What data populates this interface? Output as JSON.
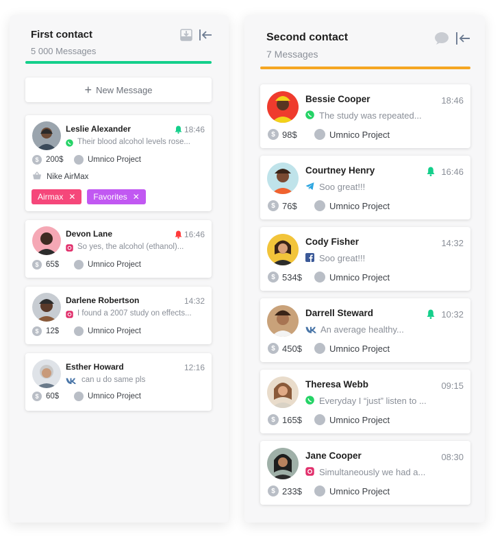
{
  "colors": {
    "green": "#14cf8b",
    "orange": "#f5a623",
    "red": "#ff3b3b",
    "tag_pink": "#f5477a",
    "tag_purple": "#c158f2",
    "muted": "#8a8f98"
  },
  "first_column": {
    "title": "First contact",
    "count": "5 000 Messages",
    "icons": [
      "inbox-download-icon",
      "collapse-left-icon"
    ],
    "new_message_label": "New Message",
    "cards": [
      {
        "name": "Leslie Alexander",
        "time": "18:46",
        "bell": "green",
        "channel": "whatsapp-icon",
        "preview": "Their blood alcohol levels rose...",
        "amount": "200$",
        "project": "Umnico Project",
        "product": "Nike AirMax",
        "tags": [
          {
            "label": "Airmax",
            "color": "#f5477a"
          },
          {
            "label": "Favorites",
            "color": "#c158f2"
          }
        ]
      },
      {
        "name": "Devon Lane",
        "time": "16:46",
        "bell": "red",
        "channel": "instagram-icon",
        "preview": "So yes, the alcohol (ethanol)...",
        "amount": "65$",
        "project": "Umnico Project"
      },
      {
        "name": "Darlene Robertson",
        "time": "14:32",
        "channel": "instagram-icon",
        "preview": "I found a 2007 study on effects...",
        "amount": "12$",
        "project": "Umnico Project"
      },
      {
        "name": "Esther Howard",
        "time": "12:16",
        "channel": "vk-icon",
        "preview": "can u do same pls",
        "amount": "60$",
        "project": "Umnico Project"
      }
    ]
  },
  "second_column": {
    "title": "Second contact",
    "count": "7 Messages",
    "icons": [
      "chat-bubble-icon",
      "collapse-left-icon"
    ],
    "cards": [
      {
        "name": "Bessie Cooper",
        "time": "18:46",
        "channel": "whatsapp-icon",
        "preview": "The study was repeated...",
        "amount": "98$",
        "project": "Umnico Project"
      },
      {
        "name": "Courtney Henry",
        "time": "16:46",
        "bell": "green",
        "channel": "telegram-icon",
        "preview": "Soo great!!!",
        "amount": "76$",
        "project": "Umnico Project"
      },
      {
        "name": "Cody Fisher",
        "time": "14:32",
        "channel": "facebook-icon",
        "preview": "Soo great!!!",
        "amount": "534$",
        "project": "Umnico Project"
      },
      {
        "name": "Darrell Steward",
        "time": "10:32",
        "bell": "green",
        "channel": "vk-icon",
        "preview": "An average healthy...",
        "amount": "450$",
        "project": "Umnico Project"
      },
      {
        "name": "Theresa Webb",
        "time": "09:15",
        "channel": "whatsapp-icon",
        "preview": "Everyday I “just” listen to ...",
        "amount": "165$",
        "project": "Umnico Project"
      },
      {
        "name": "Jane Cooper",
        "time": "08:30",
        "channel": "instagram-icon",
        "preview": "Simultaneously we had a...",
        "amount": "233$",
        "project": "Umnico Project"
      }
    ]
  }
}
